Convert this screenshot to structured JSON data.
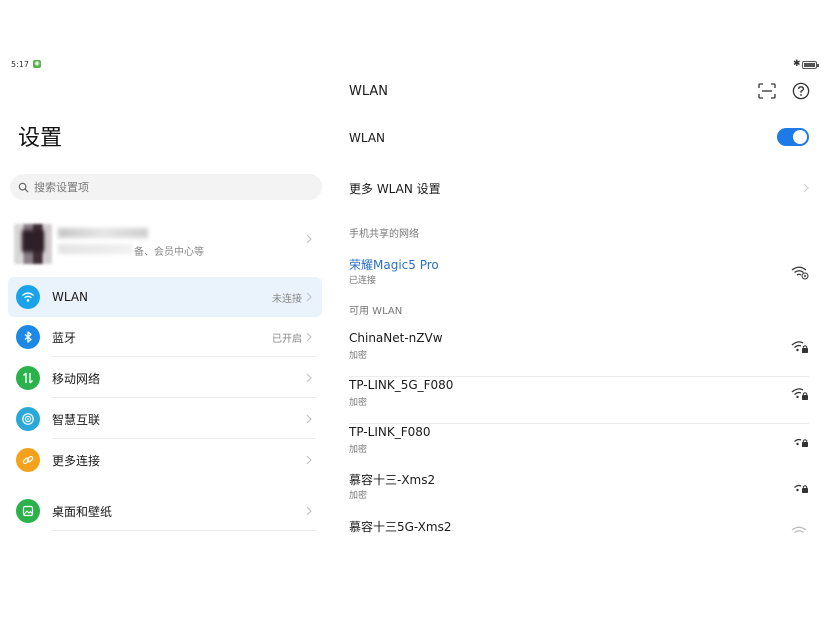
{
  "status_bar": {
    "time": "5:17"
  },
  "left": {
    "title": "设置",
    "search_placeholder": "搜索设置项",
    "account_subtitle": "备、会员中心等",
    "items": [
      {
        "label": "WLAN",
        "value": "未连接",
        "icon": "wifi-icon",
        "color": "#1aa3e8"
      },
      {
        "label": "蓝牙",
        "value": "已开启",
        "icon": "bluetooth-icon",
        "color": "#1e88e5"
      },
      {
        "label": "移动网络",
        "value": "",
        "icon": "mobile-data-icon",
        "color": "#2bb24c"
      },
      {
        "label": "智慧互联",
        "value": "",
        "icon": "smart-connect-icon",
        "color": "#2aa8d8"
      },
      {
        "label": "更多连接",
        "value": "",
        "icon": "link-icon",
        "color": "#f4a21b"
      },
      {
        "label": "桌面和壁纸",
        "value": "",
        "icon": "wallpaper-icon",
        "color": "#2bb24c"
      }
    ]
  },
  "right": {
    "title": "WLAN",
    "wlan_label": "WLAN",
    "wlan_enabled": true,
    "more_settings": "更多 WLAN 设置",
    "hotspot_section": "手机共享的网络",
    "hotspot": {
      "name": "荣耀Magic5 Pro",
      "status": "已连接"
    },
    "available_section": "可用 WLAN",
    "networks": [
      {
        "name": "ChinaNet-nZVw",
        "security": "加密"
      },
      {
        "name": "TP-LINK_5G_F080",
        "security": "加密"
      },
      {
        "name": "TP-LINK_F080",
        "security": "加密"
      },
      {
        "name": "慕容十三-Xms2",
        "security": "加密"
      },
      {
        "name": "慕容十三5G-Xms2",
        "security": ""
      }
    ]
  },
  "colors": {
    "accent": "#1e7ae6",
    "connected_text": "#2a6fc4"
  }
}
